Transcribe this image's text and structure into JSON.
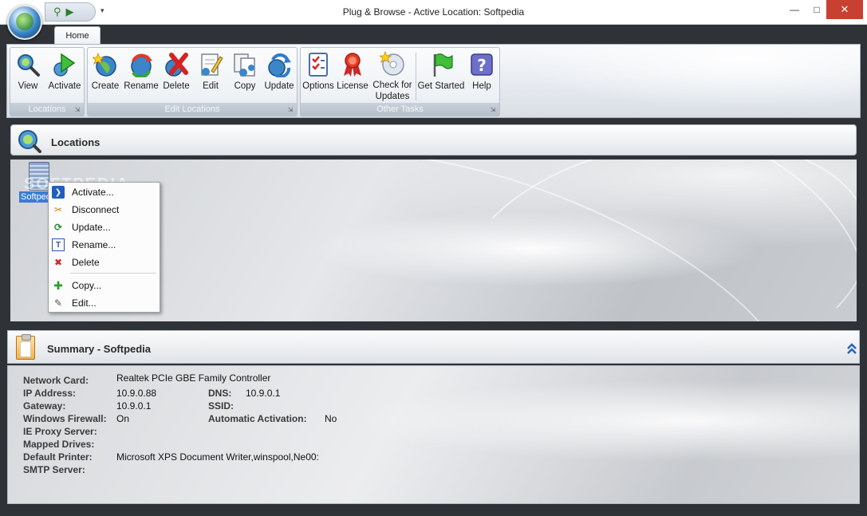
{
  "window": {
    "title": "Plug & Browse - Active Location: Softpedia",
    "min_glyph": "—",
    "max_glyph": "□",
    "close_glyph": "✕",
    "qat_dropdown_glyph": "▾"
  },
  "ribbon": {
    "tabs": [
      {
        "label": "Home"
      }
    ],
    "groups": {
      "locations": {
        "caption": "Locations",
        "buttons": [
          {
            "label": "View"
          },
          {
            "label": "Activate"
          }
        ]
      },
      "edit": {
        "caption": "Edit Locations",
        "buttons": [
          {
            "label": "Create"
          },
          {
            "label": "Rename"
          },
          {
            "label": "Delete"
          },
          {
            "label": "Edit"
          },
          {
            "label": "Copy"
          },
          {
            "label": "Update"
          }
        ]
      },
      "other": {
        "caption": "Other Tasks",
        "buttons": [
          {
            "label": "Options"
          },
          {
            "label": "License"
          },
          {
            "label": "Check for Updates"
          },
          {
            "label": "Get Started"
          },
          {
            "label": "Help"
          }
        ]
      }
    },
    "launcher_glyph": "⇲"
  },
  "locations": {
    "title": "Locations",
    "items": [
      {
        "label": "Softpedia"
      }
    ],
    "watermark": "SOFTPEDIA"
  },
  "context_menu": {
    "items": [
      {
        "label": "Activate...",
        "icon": "activate-icon",
        "glyph": "❯",
        "color": "#1f5fbf"
      },
      {
        "label": "Disconnect",
        "icon": "disconnect-icon",
        "glyph": "✂",
        "color": "#d07a1a"
      },
      {
        "label": "Update...",
        "icon": "update-icon",
        "glyph": "⟳",
        "color": "#1e8a2e"
      },
      {
        "label": "Rename...",
        "icon": "rename-icon",
        "glyph": "T",
        "color": "#2a55a8"
      },
      {
        "label": "Delete",
        "icon": "delete-icon",
        "glyph": "✖",
        "color": "#d2262a"
      },
      {
        "label": "Copy...",
        "icon": "copy-icon",
        "glyph": "✚",
        "color": "#2e9c2e"
      },
      {
        "label": "Edit...",
        "icon": "edit-icon",
        "glyph": "✎",
        "color": "#555555"
      }
    ]
  },
  "summary": {
    "title": "Summary - Softpedia",
    "collapse_glyph": "⌃⌃",
    "left": [
      {
        "key": "Network Card:",
        "value": "Realtek PCIe GBE Family Controller"
      },
      {
        "key": "IP Address:",
        "value": "10.9.0.88"
      },
      {
        "key": "Gateway:",
        "value": "10.9.0.1"
      },
      {
        "key": "Windows Firewall:",
        "value": "On"
      },
      {
        "key": "IE Proxy Server:",
        "value": ""
      },
      {
        "key": "Mapped Drives:",
        "value": ""
      },
      {
        "key": "Default Printer:",
        "value": "Microsoft XPS Document Writer,winspool,Ne00:"
      },
      {
        "key": "SMTP Server:",
        "value": ""
      }
    ],
    "right": [
      {
        "key": "DNS:",
        "value": "10.9.0.1"
      },
      {
        "key": "SSID:",
        "value": ""
      },
      {
        "key": "Automatic Activation:",
        "value": "No"
      }
    ]
  }
}
